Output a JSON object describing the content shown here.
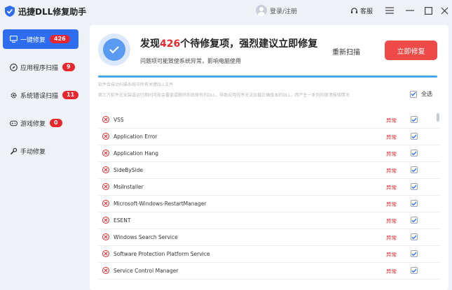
{
  "app": {
    "title": "迅捷DLL修复助手",
    "login_label": "登录/注册",
    "support_label": "客服"
  },
  "sidebar": {
    "items": [
      {
        "label": "一键修复",
        "badge": "426",
        "active": true
      },
      {
        "label": "应用程序扫描",
        "badge": "9",
        "active": false
      },
      {
        "label": "系统错误扫描",
        "badge": "11",
        "active": false
      },
      {
        "label": "游戏修复",
        "badge": "0",
        "active": false
      },
      {
        "label": "手动修复",
        "badge": "",
        "active": false
      }
    ]
  },
  "summary": {
    "prefix": "发现",
    "count": "426",
    "suffix": "个待修复项，强烈建议立即修复",
    "subtitle": "问题项可能致使系统异常，影响电脑使用",
    "rescan_label": "重新扫描",
    "fix_label": "立即修复",
    "progress": 1.0
  },
  "scan": {
    "note": "软件会自动扫描系统中所有关键DLL文件",
    "description": "第三方软件在安装或运行期间可能会覆盖或删除系统原有的DLL，导致应用程序无法加载正确版本的DLL，而产生一系列的崩溃报错情况",
    "select_all_label": "全选"
  },
  "items": [
    {
      "name": "VSS",
      "status": "异常"
    },
    {
      "name": "Application Error",
      "status": "异常"
    },
    {
      "name": "Application Hang",
      "status": "异常"
    },
    {
      "name": "SideBySide",
      "status": "异常"
    },
    {
      "name": "MsiInstaller",
      "status": "异常"
    },
    {
      "name": "Microsoft-Windows-RestartManager",
      "status": "异常"
    },
    {
      "name": "ESENT",
      "status": "异常"
    },
    {
      "name": "Windows Search Service",
      "status": "异常"
    },
    {
      "name": "Software Protection Platform Service",
      "status": "异常"
    },
    {
      "name": "Service Control Manager",
      "status": "异常"
    }
  ],
  "colors": {
    "accent": "#2f6df0",
    "danger": "#e8262e",
    "fix_button": "#ee4a48",
    "progress": "#49a6e6"
  }
}
